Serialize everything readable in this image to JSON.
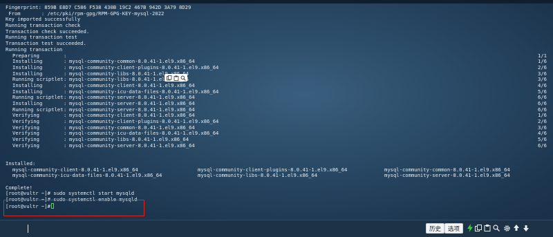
{
  "terminal": {
    "pre_lines": [
      "Fingerprint: 859B E8D7 C586 F538 430B 19C2 467B 942D 3A79 8D29",
      " From       : /etc/pki/rpm-gpg/RPM-GPG-KEY-mysql-2022",
      "Key imported successfully",
      "Running transaction check",
      "Transaction check succeeded.",
      "Running transaction test",
      "Transaction test succeeded.",
      "Running transaction"
    ],
    "transaction_rows": [
      {
        "action": "Preparing",
        "package": "",
        "count": "1/1"
      },
      {
        "action": "Installing",
        "package": "mysql-community-common-8.0.41-1.el9.x86_64",
        "count": "1/6"
      },
      {
        "action": "Installing",
        "package": "mysql-community-client-plugins-8.0.41-1.el9.x86_64",
        "count": "2/6"
      },
      {
        "action": "Installing",
        "package": "mysql-community-libs-8.0.41-1.el9.x86_64",
        "count": "3/6"
      },
      {
        "action": "Running scriptlet",
        "package": "mysql-community-libs-8.0.41-1.el9.x86_64",
        "count": "3/6"
      },
      {
        "action": "Installing",
        "package": "mysql-community-client-8.0.41-1.el9.x86_64",
        "count": "4/6"
      },
      {
        "action": "Installing",
        "package": "mysql-community-icu-data-files-8.0.41-1.el9.x86_64",
        "count": "5/6"
      },
      {
        "action": "Running scriptlet",
        "package": "mysql-community-server-8.0.41-1.el9.x86_64",
        "count": "6/6"
      },
      {
        "action": "Installing",
        "package": "mysql-community-server-8.0.41-1.el9.x86_64",
        "count": "6/6"
      },
      {
        "action": "Running scriptlet",
        "package": "mysql-community-server-8.0.41-1.el9.x86_64",
        "count": "6/6"
      },
      {
        "action": "Verifying",
        "package": "mysql-community-client-8.0.41-1.el9.x86_64",
        "count": "1/6"
      },
      {
        "action": "Verifying",
        "package": "mysql-community-client-plugins-8.0.41-1.el9.x86_64",
        "count": "2/6"
      },
      {
        "action": "Verifying",
        "package": "mysql-community-common-8.0.41-1.el9.x86_64",
        "count": "3/6"
      },
      {
        "action": "Verifying",
        "package": "mysql-community-icu-data-files-8.0.41-1.el9.x86_64",
        "count": "4/6"
      },
      {
        "action": "Verifying",
        "package": "mysql-community-libs-8.0.41-1.el9.x86_64",
        "count": "5/6"
      },
      {
        "action": "Verifying",
        "package": "mysql-community-server-8.0.41-1.el9.x86_64",
        "count": "6/6"
      }
    ],
    "installed_header": "Installed:",
    "installed_rows": [
      [
        "mysql-community-client-8.0.41-1.el9.x86_64",
        "mysql-community-client-plugins-8.0.41-1.el9.x86_64",
        "mysql-community-common-8.0.41-1.el9.x86_64"
      ],
      [
        "mysql-community-icu-data-files-8.0.41-1.el9.x86_64",
        "mysql-community-libs-8.0.41-1.el9.x86_64",
        "mysql-community-server-8.0.41-1.el9.x86_64"
      ]
    ],
    "complete": "Complete!",
    "cmd1": "[root@vultr ~]# sudo systemctl start mysqld",
    "cmd2": "[root@vultr ~]# sudo systemctl enable mysqld",
    "prompt": "[root@vultr ~]#"
  },
  "mini_toolbar": {
    "icons": [
      "copy-icon",
      "paste-icon",
      "search-icon"
    ]
  },
  "bottom_bar": {
    "history_label": "历史",
    "options_label": "选项",
    "icons": [
      "lightning-icon",
      "copy-icon",
      "paste-icon",
      "search-icon",
      "gear-icon",
      "upload-icon",
      "download-icon"
    ],
    "lightning_color": "#3ecf3e"
  },
  "colors": {
    "highlight_border": "#e0251b",
    "prompt_cursor": "#5bd35b"
  }
}
